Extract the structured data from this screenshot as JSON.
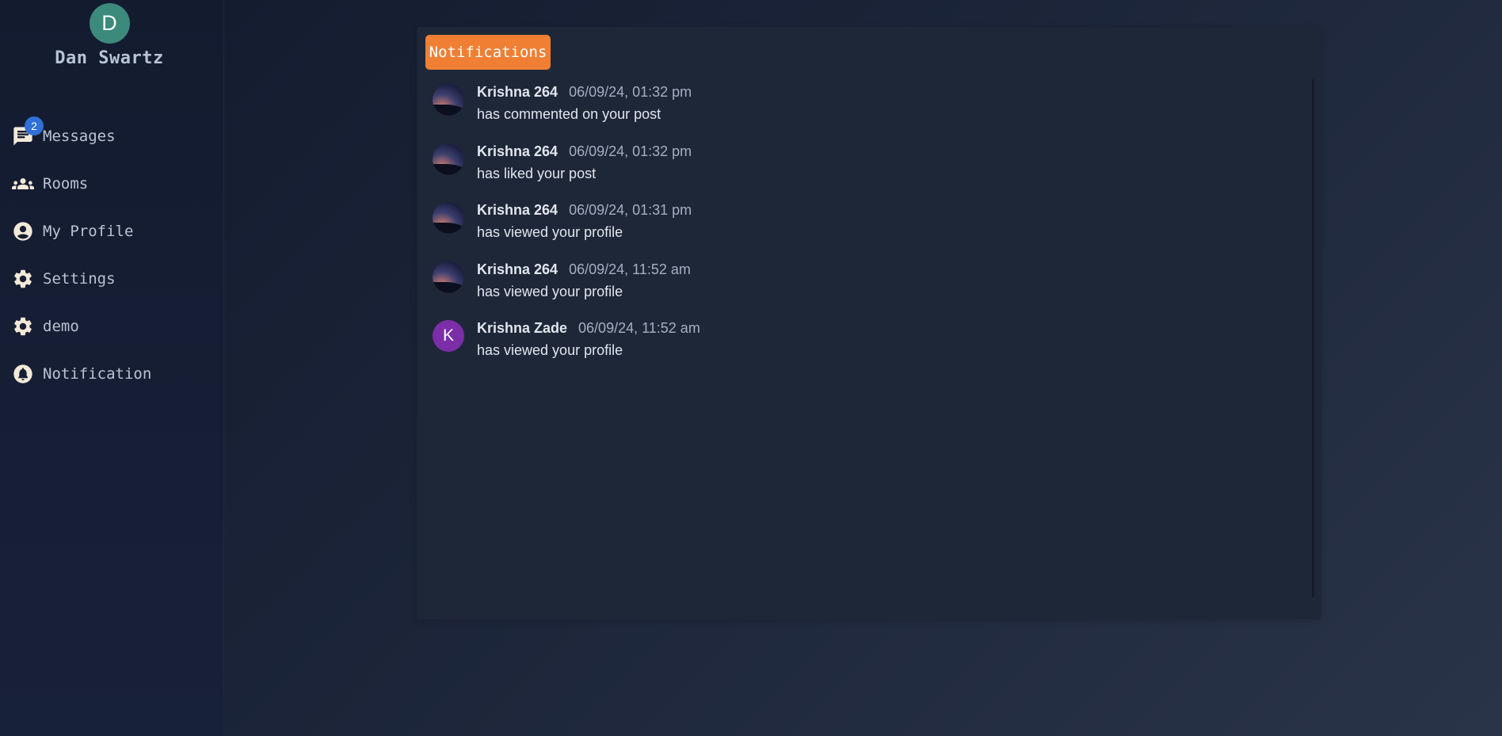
{
  "user": {
    "initial": "D",
    "name": "Dan Swartz",
    "avatar_color": "#3b8a7c"
  },
  "sidebar": {
    "items": [
      {
        "label": "Messages",
        "icon": "chat-icon",
        "badge": "2"
      },
      {
        "label": "Rooms",
        "icon": "group-icon"
      },
      {
        "label": "My Profile",
        "icon": "account-circle-icon"
      },
      {
        "label": "Settings",
        "icon": "gear-icon"
      },
      {
        "label": "demo",
        "icon": "gear-icon"
      },
      {
        "label": "Notification",
        "icon": "bell-icon"
      }
    ]
  },
  "panel": {
    "button_label": "Notifications",
    "accent_color": "#f07f34"
  },
  "notifications": [
    {
      "name": "Krishna 264",
      "time": "06/09/24, 01:32 pm",
      "message": "has commented on your post",
      "avatar": "photo"
    },
    {
      "name": "Krishna 264",
      "time": "06/09/24, 01:32 pm",
      "message": "has liked your post",
      "avatar": "photo"
    },
    {
      "name": "Krishna 264",
      "time": "06/09/24, 01:31 pm",
      "message": "has viewed your profile",
      "avatar": "photo"
    },
    {
      "name": "Krishna 264",
      "time": "06/09/24, 11:52 am",
      "message": "has viewed your profile",
      "avatar": "photo"
    },
    {
      "name": "Krishna Zade",
      "time": "06/09/24, 11:52 am",
      "message": "has viewed your profile",
      "avatar": "letter",
      "initial": "K",
      "avatar_color": "#7b2ea8"
    }
  ]
}
